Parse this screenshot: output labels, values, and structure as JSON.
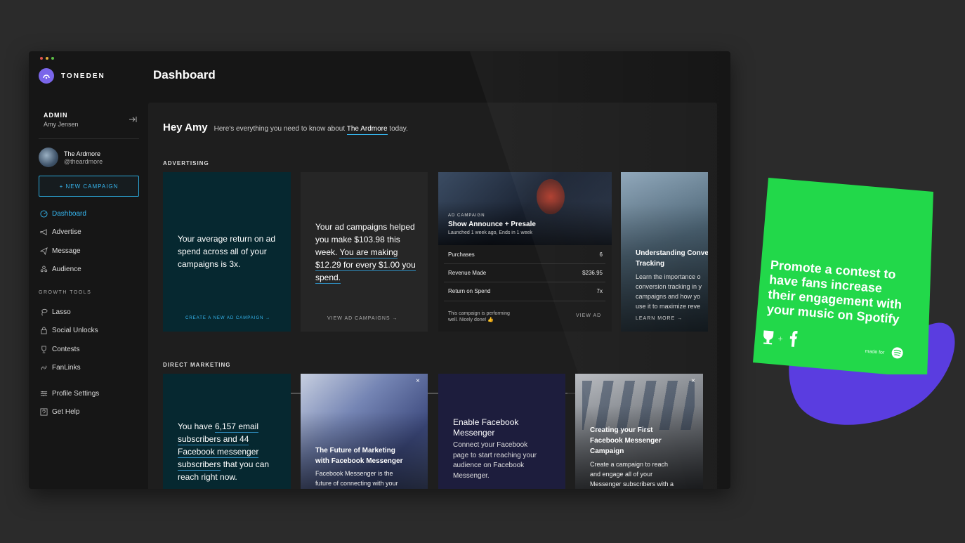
{
  "brand": {
    "name": "TONEDEN"
  },
  "header": {
    "title": "Dashboard"
  },
  "window_dots": [
    "#e2544c",
    "#e1ad3b",
    "#5ec047"
  ],
  "sidebar": {
    "admin_title": "ADMIN",
    "admin_name": "Amy Jensen",
    "account_name": "The Ardmore",
    "account_handle": "@theardmore",
    "new_campaign": "+ NEW CAMPAIGN",
    "nav": [
      {
        "label": "Dashboard",
        "icon": "dashboard-icon",
        "active": true
      },
      {
        "label": "Advertise",
        "icon": "megaphone-icon"
      },
      {
        "label": "Message",
        "icon": "paper-plane-icon"
      },
      {
        "label": "Audience",
        "icon": "people-icon"
      }
    ],
    "growth_label": "GROWTH TOOLS",
    "growth": [
      {
        "label": "Lasso",
        "icon": "lasso-icon"
      },
      {
        "label": "Social Unlocks",
        "icon": "lock-icon"
      },
      {
        "label": "Contests",
        "icon": "trophy-icon"
      },
      {
        "label": "FanLinks",
        "icon": "link-icon"
      }
    ],
    "bottom": [
      {
        "label": "Profile Settings",
        "icon": "sliders-icon"
      },
      {
        "label": "Get Help",
        "icon": "help-icon"
      }
    ]
  },
  "greeting": {
    "hey": "Hey Amy",
    "pre": "Here's everything you need to know about",
    "venue": "The Ardmore",
    "post": "today."
  },
  "advertising": {
    "label": "ADVERTISING",
    "card1": {
      "text": "Your average return on ad spend across all of your campaigns is 3x.",
      "link": "CREATE A NEW AD CAMPAIGN →"
    },
    "card2": {
      "line1": "Your ad campaigns helped you make",
      "line2": "$103.98 this week.",
      "line3": "You are making $12.29 for every $1.00 you spend.",
      "link": "VIEW AD CAMPAIGNS →"
    },
    "card3": {
      "tag": "AD CAMPAIGN",
      "title": "Show Announce + Presale",
      "meta": "Launched 1 week ago, Ends in 1 week",
      "rows": [
        {
          "label": "Purchases",
          "value": "6"
        },
        {
          "label": "Revenue Made",
          "value": "$236.95"
        },
        {
          "label": "Return on Spend",
          "value": "7x"
        }
      ],
      "note1": "This campaign is performing",
      "note2": "well. Nicely done! 👍",
      "link": "VIEW AD"
    },
    "card4": {
      "title1": "Understanding Conve",
      "title2": "Tracking",
      "body1": "Learn the importance o",
      "body2": "conversion tracking in y",
      "body3": "campaigns and how yo",
      "body4": "use it to maximize reve",
      "link": "LEARN MORE →"
    }
  },
  "direct": {
    "label": "DIRECT MARKETING",
    "card1": {
      "l1": "You have ",
      "l1b": "6,157 email",
      "l2": "subscribers and 44",
      "l3": "Facebook messenger",
      "l4a": "subscribers",
      "l4b": " that you can",
      "l5": "reach right now."
    },
    "card2": {
      "title1": "The Future of Marketing",
      "title2": "with Facebook Messenger",
      "body1": "Facebook Messenger is the",
      "body2": "future of connecting with your",
      "close": "×"
    },
    "card3": {
      "title1": "Enable Facebook",
      "title2": "Messenger",
      "body1": "Connect your Facebook",
      "body2": "page to start reaching your",
      "body3": "audience on Facebook",
      "body4": "Messenger."
    },
    "card4": {
      "title1": "Creating your First",
      "title2": "Facebook Messenger",
      "title3": "Campaign",
      "body1": "Create a campaign to reach",
      "body2": "and engage all of your",
      "body3": "Messenger subscribers with a",
      "close": "×"
    }
  },
  "promo": {
    "line1": "Promote a contest to",
    "line2": "have fans increase",
    "line3": "their engagement with",
    "line4": "your music on Spotify",
    "plus": "+",
    "made_for": "made for",
    "bg": "#22d84a",
    "blob": "#5a3de0"
  }
}
